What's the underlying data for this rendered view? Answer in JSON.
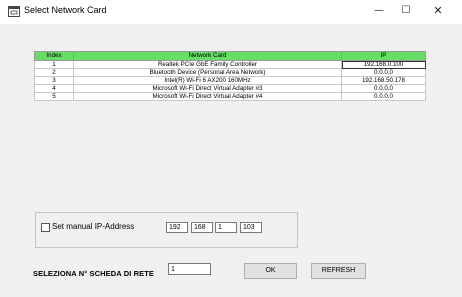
{
  "window": {
    "title": "Select Network Card",
    "minimize": "—",
    "maximize": "☐",
    "close": "✕"
  },
  "table": {
    "headers": [
      "Index",
      "Network Card",
      "IP"
    ],
    "rows": [
      {
        "index": "1",
        "card": "Realtek PCIe GbE Family Controller",
        "ip": "192.168.0.100"
      },
      {
        "index": "2",
        "card": "Bluetooth Device (Personal Area Network)",
        "ip": "0.0.0.0"
      },
      {
        "index": "3",
        "card": "Intel(R) Wi-Fi 6 AX200 160MHz",
        "ip": "192.168.50.178"
      },
      {
        "index": "4",
        "card": "Microsoft Wi-Fi Direct Virtual Adapter #3",
        "ip": "0.0.0.0"
      },
      {
        "index": "5",
        "card": "Microsoft Wi-Fi Direct Virtual Adapter #4",
        "ip": "0.0.0.0"
      }
    ],
    "header_color": "#66dd66"
  },
  "manual_ip": {
    "label": "Set manual IP-Address",
    "checked": false,
    "octets": [
      "192",
      "168",
      "1",
      "103"
    ]
  },
  "select_card": {
    "label": "SELEZIONA N° SCHEDA DI RETE",
    "value": "1",
    "ok_label": "OK",
    "refresh_label": "REFRESH"
  }
}
